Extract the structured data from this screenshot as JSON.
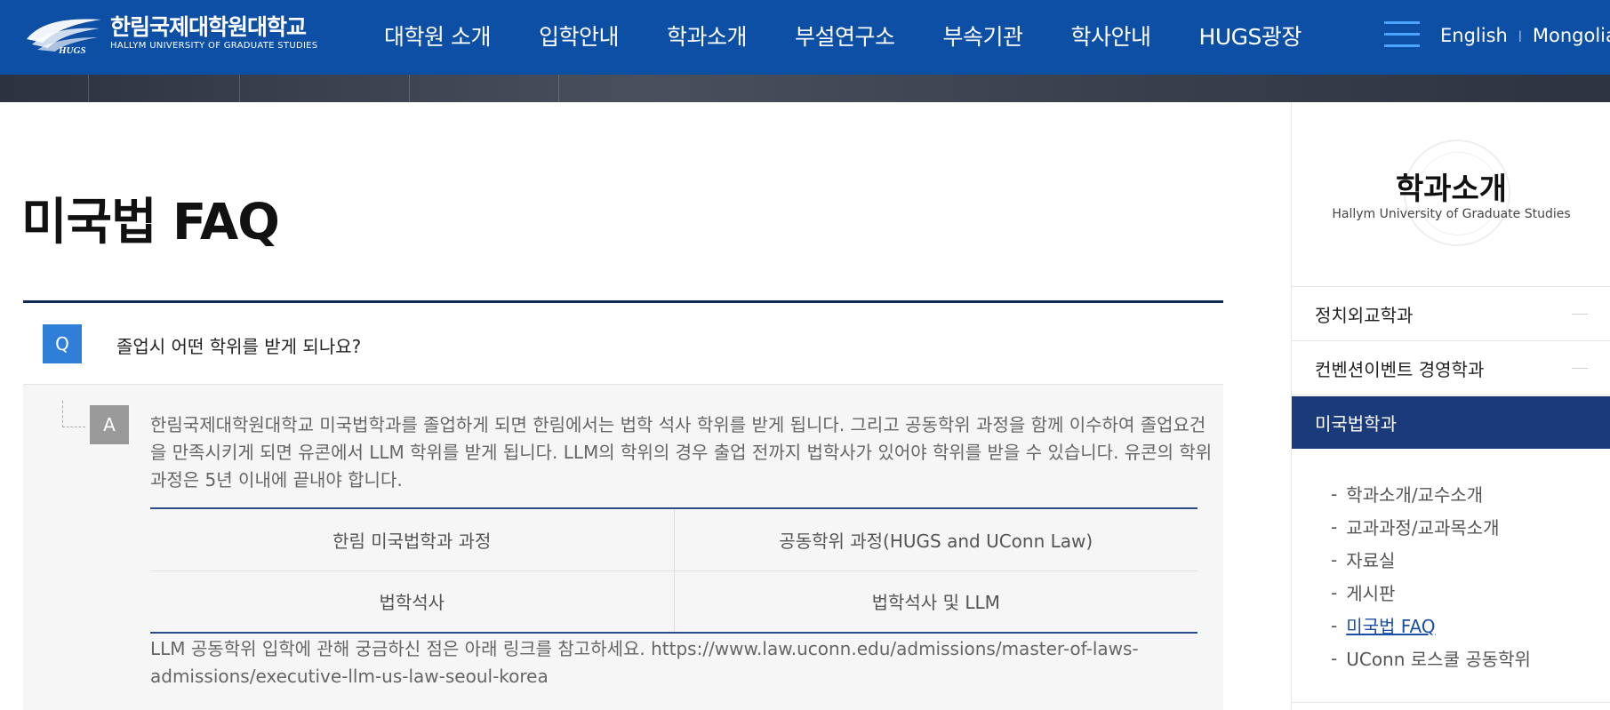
{
  "header": {
    "logo_ko": "한림국제대학원대학교",
    "logo_mark": "HUGS",
    "logo_en": "HALLYM UNIVERSITY OF GRADUATE STUDIES",
    "nav": [
      {
        "label": "대학원 소개"
      },
      {
        "label": "입학안내"
      },
      {
        "label": "학과소개"
      },
      {
        "label": "부설연구소"
      },
      {
        "label": "부속기관"
      },
      {
        "label": "학사안내"
      },
      {
        "label": "HUGS광장"
      }
    ],
    "lang_en": "English",
    "lang_separator": "|",
    "lang_mn": "Mongolian"
  },
  "main": {
    "title": "미국법 FAQ",
    "question_badge": "Q",
    "question": "졸업시 어떤 학위를 받게 되나요?",
    "answer_badge": "A",
    "answer": "한림국제대학원대학교 미국법학과를 졸업하게 되면 한림에서는 법학 석사 학위를 받게 됩니다. 그리고 공동학위 과정을 함께 이수하여 졸업요건을 만족시키게 되면 유콘에서 LLM 학위를 받게 됩니다. LLM의 학위의 경우 출업 전까지 법학사가 있어야 학위를 받을 수 있습니다. 유콘의 학위 과정은 5년 이내에 끝내야 합니다.",
    "table": {
      "rows": [
        [
          "한림 미국법학과 과정",
          "공동학위 과정(HUGS and UConn Law)"
        ],
        [
          "법학석사",
          "법학석사 및 LLM"
        ]
      ]
    },
    "note": "LLM 공동학위 입학에 관해 궁금하신 점은 아래 링크를 참고하세요. https://www.law.uconn.edu/admissions/master-of-laws-admissions/executive-llm-us-law-seoul-korea"
  },
  "sidebar": {
    "title": "학과소개",
    "subtitle": "Hallym University of Graduate Studies",
    "items": [
      {
        "label": "정치외교학과"
      },
      {
        "label": "컨벤션이벤트 경영학과"
      },
      {
        "label": "미국법학과"
      }
    ],
    "bullet": "-",
    "sub_items": [
      {
        "label": "학과소개/교수소개"
      },
      {
        "label": "교과과정/교과목소개"
      },
      {
        "label": "자료실"
      },
      {
        "label": "게시판"
      },
      {
        "label": "미국법 FAQ"
      },
      {
        "label": "UConn 로스쿨 공동학위"
      }
    ]
  },
  "colors": {
    "header_bg": "#0d4fa5",
    "active_sidebar_bg": "#1a3a7a",
    "q_badge": "#2f7ed8",
    "a_badge": "#9a9a9a"
  }
}
